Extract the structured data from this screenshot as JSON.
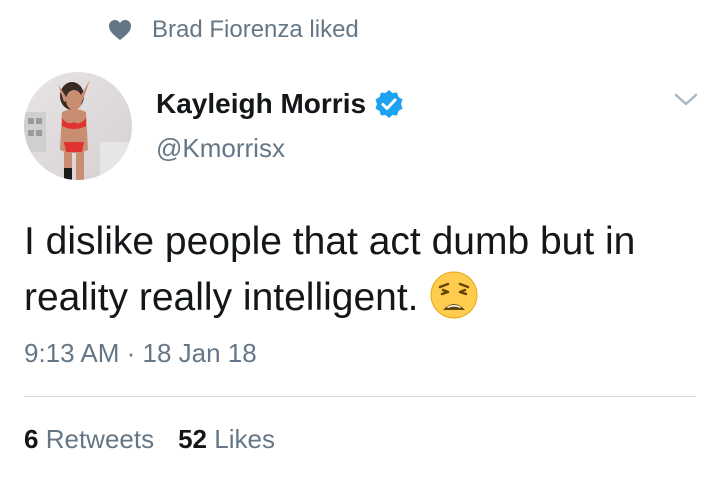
{
  "context": {
    "liked_by_text": "Brad Fiorenza liked",
    "icon": "heart-icon"
  },
  "author": {
    "name": "Kayleigh Morris",
    "handle": "@Kmorrisx",
    "verified": true,
    "verified_color": "#1da1f2"
  },
  "tweet": {
    "text": "I dislike people that act dumb but in reality really intelligent.",
    "emoji": "weary-face-emoji",
    "timestamp": "9:13 AM · 18 Jan 18"
  },
  "stats": {
    "retweets_count": "6",
    "retweets_label": "Retweets",
    "likes_count": "52",
    "likes_label": "Likes"
  },
  "colors": {
    "text_primary": "#14171a",
    "text_secondary": "#657786",
    "divider": "#ccd6dd"
  }
}
